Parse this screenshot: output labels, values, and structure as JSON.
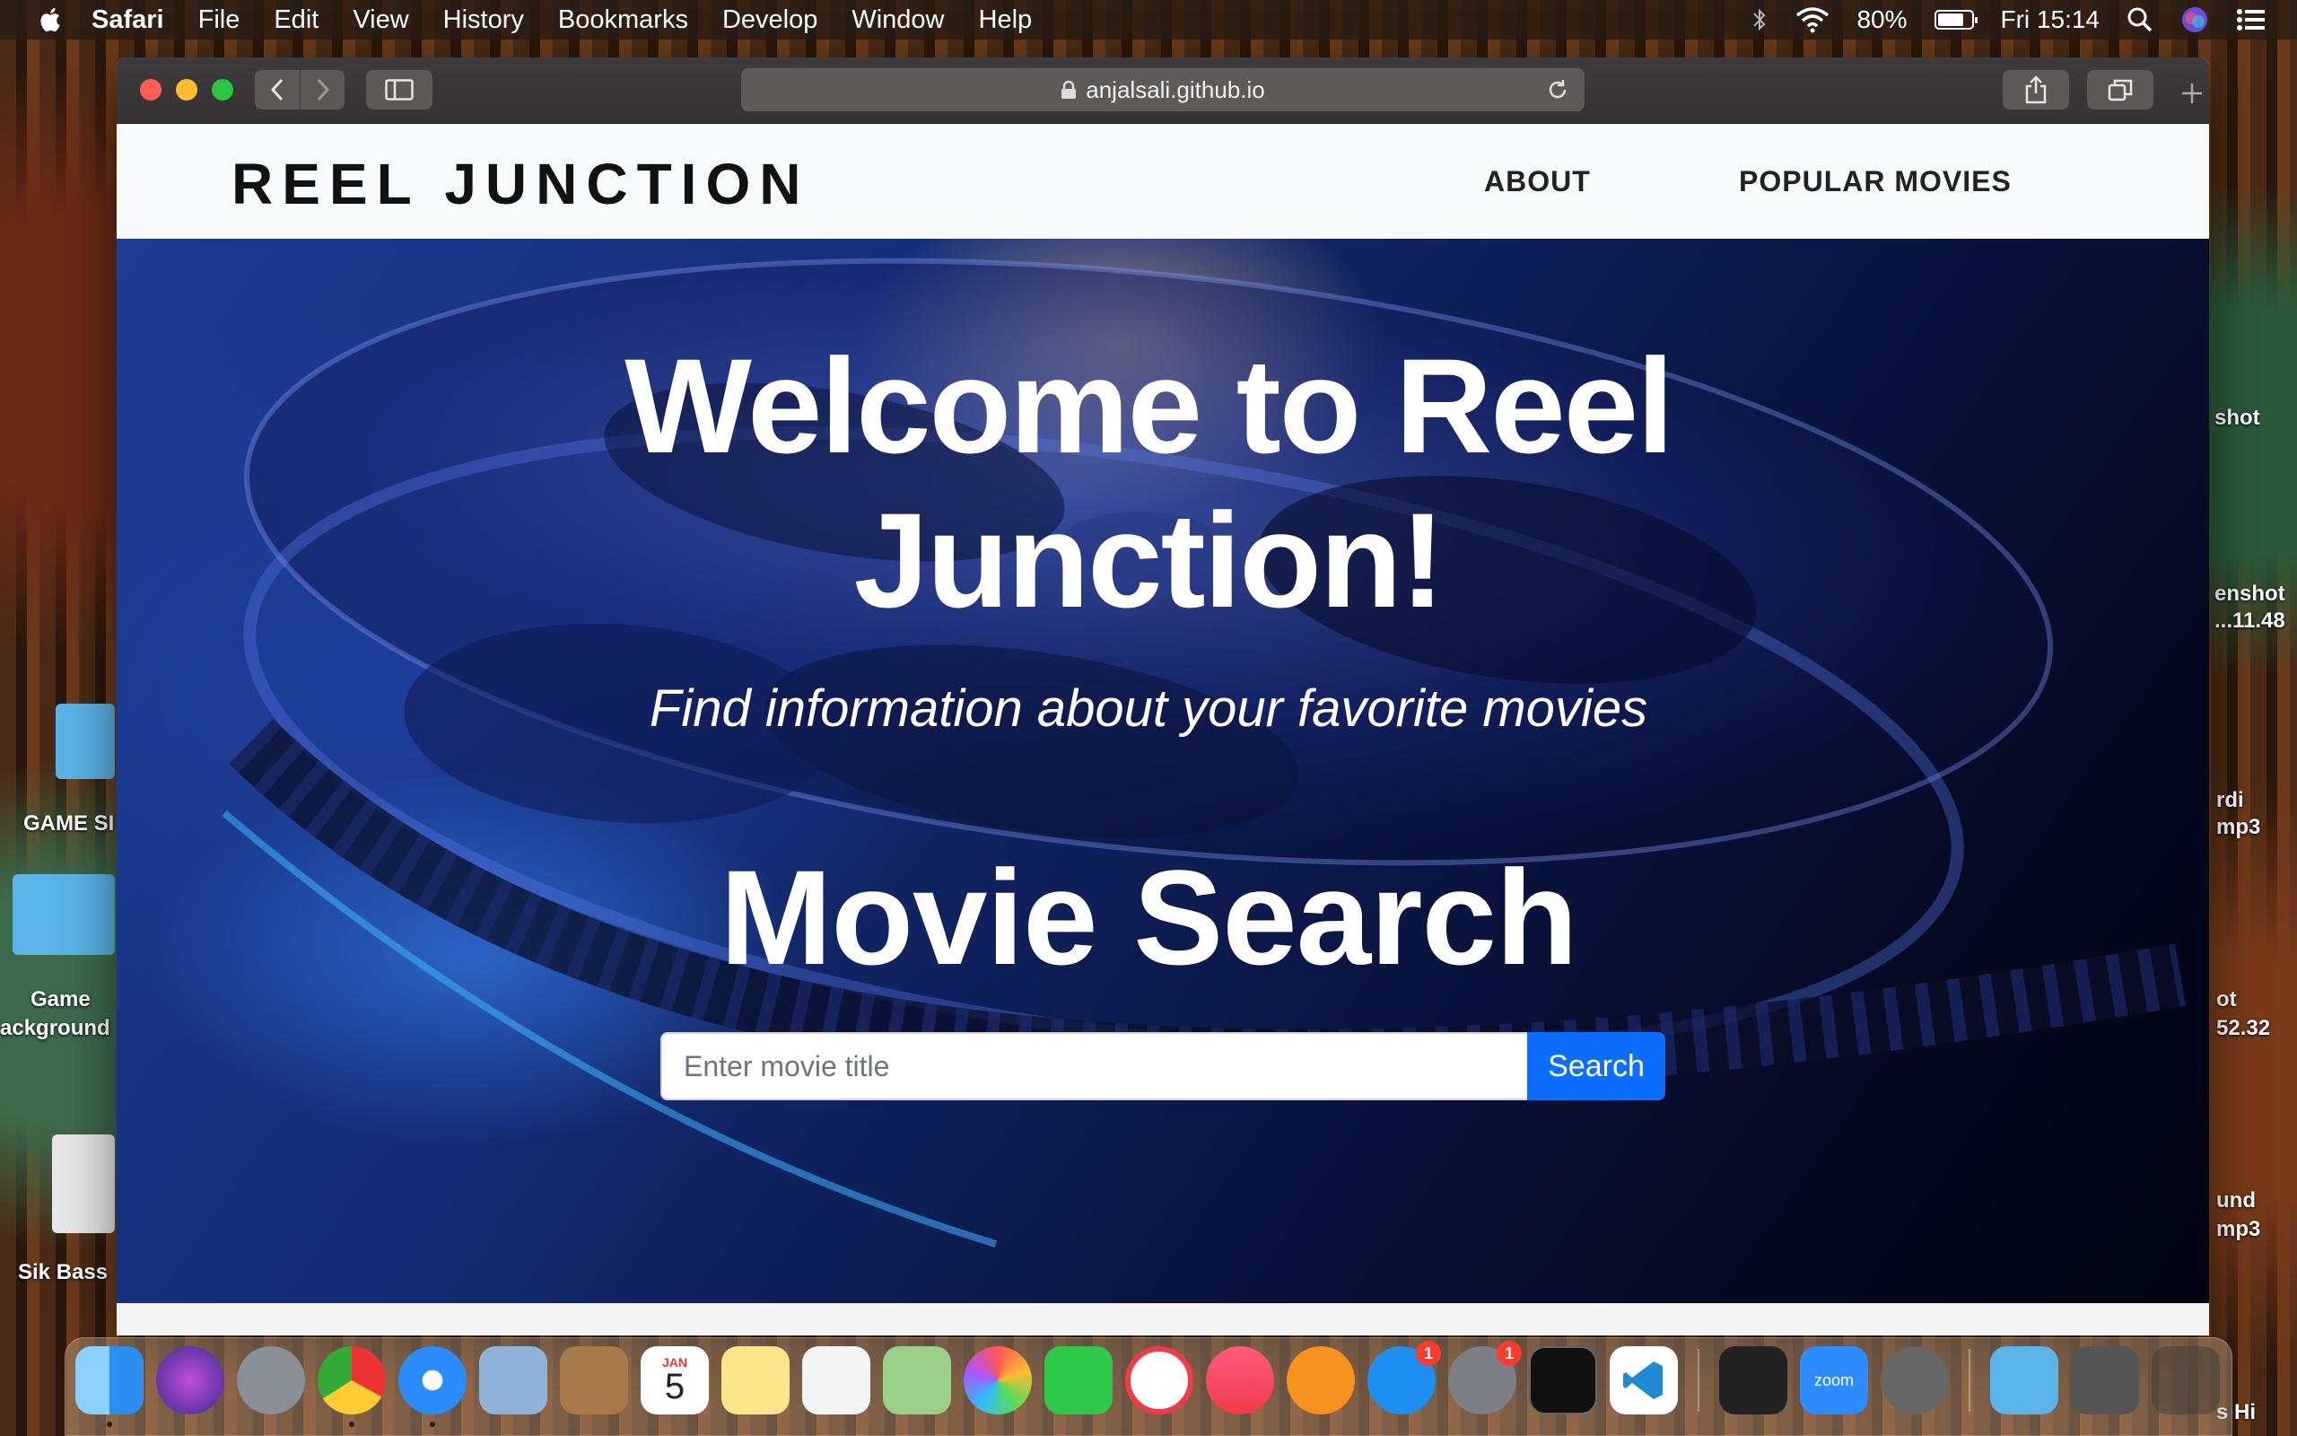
{
  "menubar": {
    "app_name": "Safari",
    "items": [
      "File",
      "Edit",
      "View",
      "History",
      "Bookmarks",
      "Develop",
      "Window",
      "Help"
    ],
    "battery": "80%",
    "battery_level": 0.8,
    "clock": "Fri 15:14"
  },
  "browser": {
    "url": "anjalsali.github.io"
  },
  "site": {
    "brand": "REEL JUNCTION",
    "nav": {
      "about": "ABOUT",
      "popular": "POPULAR MOVIES"
    },
    "hero": {
      "title": "Welcome to Reel Junction!",
      "subtitle": "Find information about your favorite movies",
      "search_title": "Movie Search",
      "search_placeholder": "Enter movie title",
      "search_button": "Search"
    }
  },
  "desktop": {
    "labels": [
      "GAME SI",
      "Game",
      "ackground",
      "Sik Bass",
      "shot",
      "enshot",
      "...11.48",
      "rdi",
      "mp3",
      "ot",
      "52.32",
      "und",
      "mp3",
      "s Hi"
    ]
  },
  "dock": {
    "calendar_month": "JAN",
    "calendar_day": "5",
    "appstore_badge": "1",
    "settings_badge": "1",
    "zoom_label": "zoom"
  }
}
